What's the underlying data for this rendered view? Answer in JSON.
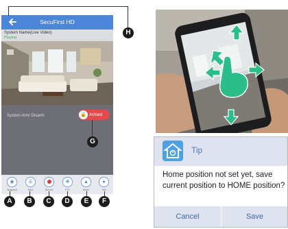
{
  "app": {
    "title": "SecuFirst HD",
    "back_icon": "arrow-left-icon"
  },
  "info": {
    "system_name": "System Name(Live Video)",
    "status": "Playing"
  },
  "arm": {
    "label": "System Arm/ Disarm",
    "button_label": "Armed",
    "icon": "lock-icon"
  },
  "toolbar": [
    {
      "label": "Snapshot",
      "icon": "camera-icon"
    },
    {
      "label": "Hear",
      "icon": "speaker-icon"
    },
    {
      "label": "Record",
      "icon": "record-icon"
    },
    {
      "label": "PTZ",
      "icon": "ptz-icon"
    },
    {
      "label": "Alarm",
      "icon": "alarm-icon"
    },
    {
      "label": "Talk",
      "icon": "microphone-icon"
    }
  ],
  "callouts": {
    "a": "A",
    "b": "B",
    "c": "C",
    "d": "D",
    "e": "E",
    "f": "F",
    "g": "G",
    "h": "H"
  },
  "dialog": {
    "title": "Tip",
    "message": "Home position not set yet, save current position to HOME position?",
    "cancel": "Cancel",
    "save": "Save",
    "icon": "home-icon"
  },
  "colors": {
    "app_bar": "#4b86d8",
    "armed": "#e24a4e",
    "playing": "#3ab54a",
    "gesture_arrows": "#2bbd8a",
    "dialog_header": "#dfe3ef",
    "dialog_icon": "#4ea0e4"
  }
}
